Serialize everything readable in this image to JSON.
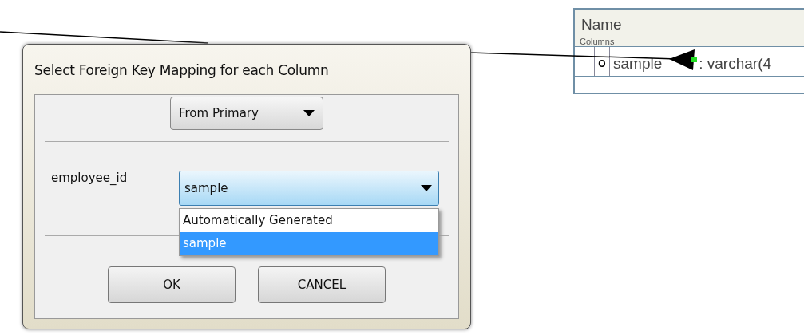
{
  "diagram_table": {
    "title": "Name",
    "section": "Columns",
    "rows": [
      {
        "marker": "O",
        "name": "sample",
        "type": ": varchar(4"
      }
    ]
  },
  "dialog": {
    "title": "Select Foreign Key Mapping for each Column",
    "mode_select": {
      "value": "From Primary"
    },
    "mappings": [
      {
        "label": "employee_id",
        "value": "sample",
        "expanded": true,
        "options": [
          {
            "label": "Automatically Generated",
            "selected": false
          },
          {
            "label": "sample",
            "selected": true
          }
        ]
      }
    ],
    "buttons": [
      "OK",
      "CANCEL"
    ]
  }
}
